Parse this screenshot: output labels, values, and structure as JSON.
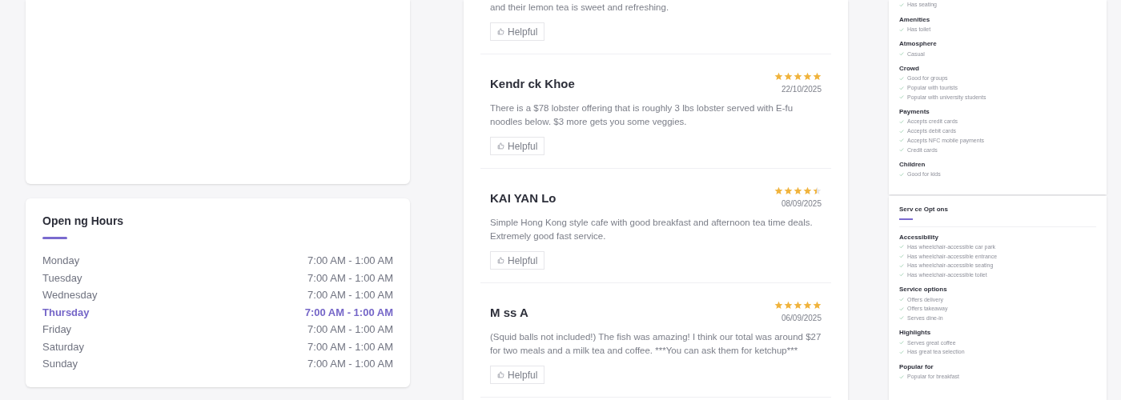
{
  "opening_hours": {
    "title": "Open ng Hours",
    "days": [
      {
        "day": "Monday",
        "hours": "7:00 AM - 1:00 AM",
        "today": false
      },
      {
        "day": "Tuesday",
        "hours": "7:00 AM - 1:00 AM",
        "today": false
      },
      {
        "day": "Wednesday",
        "hours": "7:00 AM - 1:00 AM",
        "today": false
      },
      {
        "day": "Thursday",
        "hours": "7:00 AM - 1:00 AM",
        "today": true
      },
      {
        "day": "Friday",
        "hours": "7:00 AM - 1:00 AM",
        "today": false
      },
      {
        "day": "Saturday",
        "hours": "7:00 AM - 1:00 AM",
        "today": false
      },
      {
        "day": "Sunday",
        "hours": "7:00 AM - 1:00 AM",
        "today": false
      }
    ]
  },
  "reviews": [
    {
      "text": "and their lemon tea is sweet and refreshing.",
      "helpful": "Helpful"
    },
    {
      "author": "Kendr ck Khoe",
      "stars": 5,
      "date": "22/10/2025",
      "text": "There is a $78 lobster offering that is roughly 3 lbs lobster served with E-fu noodles below. $3 more gets you some veggies.",
      "helpful": "Helpful"
    },
    {
      "author": "KAI YAN Lo",
      "stars": 4.5,
      "date": "08/09/2025",
      "text": "Simple Hong Kong style cafe with good breakfast and afternoon tea time deals. Extremely good fast service.",
      "helpful": "Helpful"
    },
    {
      "author": "M ss A",
      "stars": 5,
      "date": "06/09/2025",
      "text": "(Squid balls not included!) The fish was amazing! I think our total was around $27 for two meals and a milk tea and coffee. ***You can ask them for ketchup***",
      "helpful": "Helpful"
    }
  ],
  "about": {
    "groups": [
      {
        "items": [
          "Has seating"
        ]
      },
      {
        "heading": "Amenities",
        "items": [
          "Has toilet"
        ]
      },
      {
        "heading": "Atmosphere",
        "items": [
          "Casual"
        ]
      },
      {
        "heading": "Crowd",
        "items": [
          "Good for groups",
          "Popular with tourists",
          "Popular with university students"
        ]
      },
      {
        "heading": "Payments",
        "items": [
          "Accepts credit cards",
          "Accepts debit cards",
          "Accepts NFC mobile payments",
          "Credit cards"
        ]
      },
      {
        "heading": "Children",
        "items": [
          "Good for kids"
        ]
      }
    ]
  },
  "service_options": {
    "title": "Serv ce Opt ons",
    "groups": [
      {
        "heading": "Accessibility",
        "items": [
          "Has wheelchair-accessible car park",
          "Has wheelchair-accessible entrance",
          "Has wheelchair-accessible seating",
          "Has wheelchair-accessible toilet"
        ]
      },
      {
        "heading": "Service options",
        "items": [
          "Offers delivery",
          "Offers takeaway",
          "Serves dine-in"
        ]
      },
      {
        "heading": "Highlights",
        "items": [
          "Serves great coffee",
          "Has great tea selection"
        ]
      },
      {
        "heading": "Popular for",
        "items": [
          "Popular for breakfast"
        ]
      }
    ]
  }
}
